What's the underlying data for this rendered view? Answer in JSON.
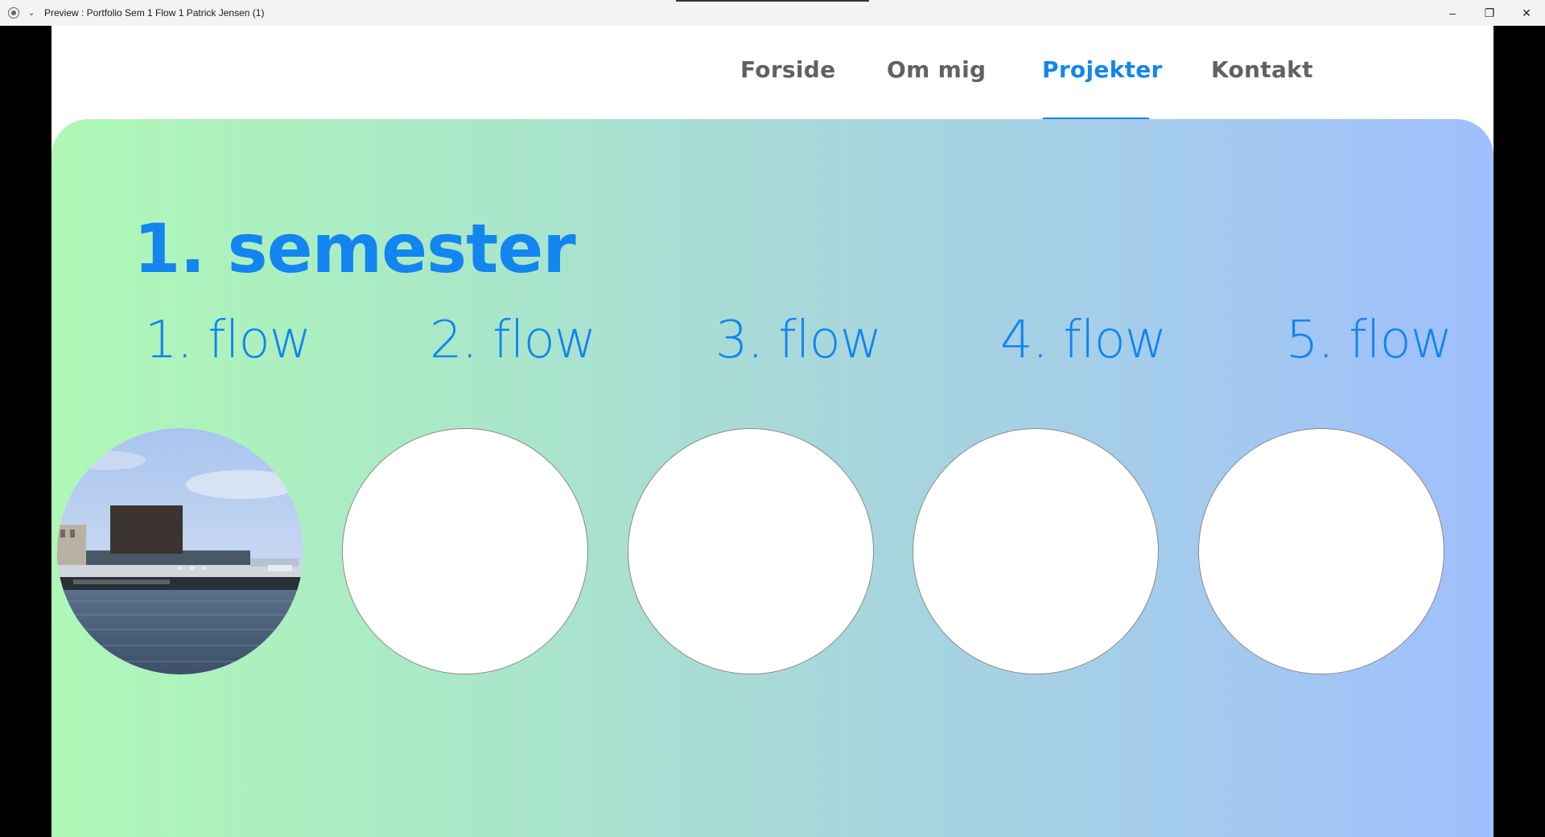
{
  "window": {
    "title": "Preview : Portfolio Sem 1 Flow 1 Patrick Jensen (1)",
    "minimize_glyph": "–",
    "restore_glyph": "❐",
    "close_glyph": "✕",
    "menu_glyph": "⌄"
  },
  "nav": {
    "items": [
      {
        "label": "Forside"
      },
      {
        "label": "Om mig"
      },
      {
        "label": "Projekter"
      },
      {
        "label": "Kontakt"
      }
    ],
    "active_index": 2
  },
  "page": {
    "heading": "1. semester",
    "flows": [
      {
        "label": "1. flow",
        "image": "opera-house-harbor-photo"
      },
      {
        "label": "2. flow",
        "image": null
      },
      {
        "label": "3. flow",
        "image": null
      },
      {
        "label": "4. flow",
        "image": null
      },
      {
        "label": "5. flow",
        "image": null
      }
    ]
  },
  "colors": {
    "accent": "#1285f0",
    "nav_text": "#616161",
    "gradient_start": "#aff8b6",
    "gradient_end": "#9fbffd"
  }
}
